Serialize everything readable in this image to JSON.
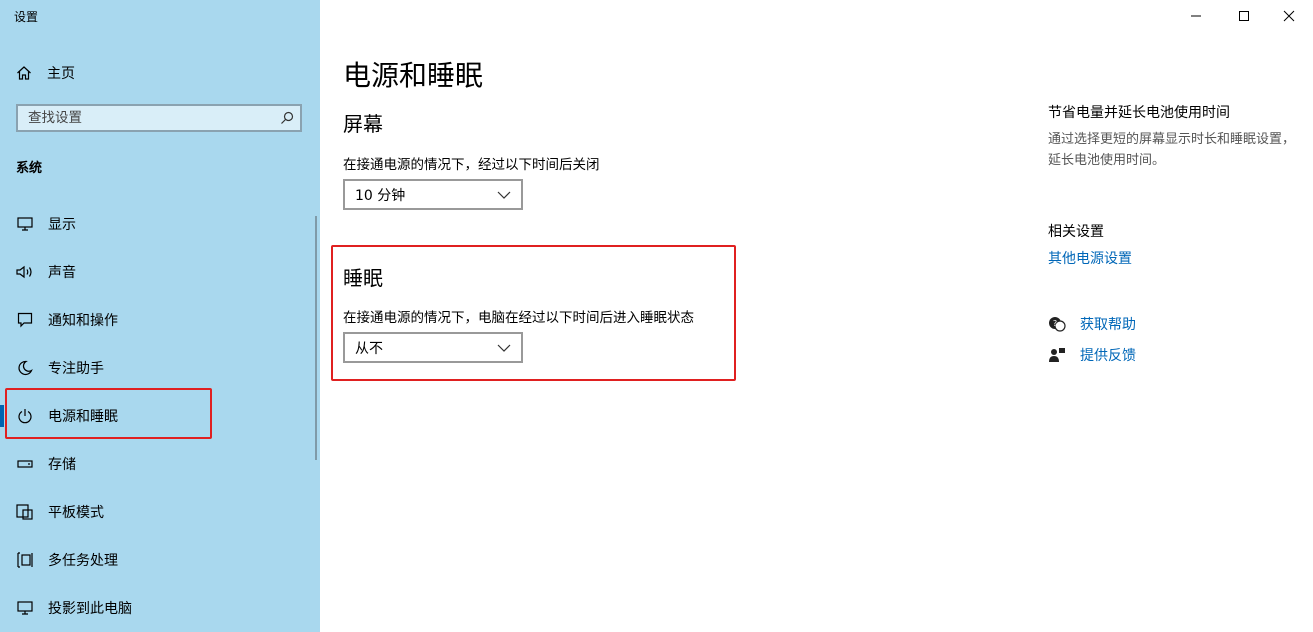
{
  "window": {
    "title": "设置",
    "minimize_glyph": "—",
    "maximize_glyph": "☐",
    "close_glyph": "✕"
  },
  "sidebar": {
    "home": {
      "label": "主页",
      "icon": "home-icon"
    },
    "search": {
      "placeholder": "查找设置",
      "icon": "search-icon"
    },
    "section": "系统",
    "items": [
      {
        "label": "显示",
        "icon": "display-icon"
      },
      {
        "label": "声音",
        "icon": "speaker-icon"
      },
      {
        "label": "通知和操作",
        "icon": "notification-icon"
      },
      {
        "label": "专注助手",
        "icon": "moon-icon"
      },
      {
        "label": "电源和睡眠",
        "icon": "power-icon",
        "selected": true
      },
      {
        "label": "存储",
        "icon": "storage-icon"
      },
      {
        "label": "平板模式",
        "icon": "tablet-icon"
      },
      {
        "label": "多任务处理",
        "icon": "multitask-icon"
      },
      {
        "label": "投影到此电脑",
        "icon": "project-icon"
      }
    ]
  },
  "main": {
    "title": "电源和睡眠",
    "screen": {
      "heading": "屏幕",
      "description": "在接通电源的情况下，经过以下时间后关闭",
      "value": "10 分钟"
    },
    "sleep": {
      "heading": "睡眠",
      "description": "在接通电源的情况下，电脑在经过以下时间后进入睡眠状态",
      "value": "从不"
    }
  },
  "right_panel": {
    "tip_title": "节省电量并延长电池使用时间",
    "tip_text": "通过选择更短的屏幕显示时长和睡眠设置，延长电池使用时间。",
    "related_title": "相关设置",
    "related_link": "其他电源设置",
    "help": {
      "label": "获取帮助",
      "icon": "help-chat-icon"
    },
    "feedback": {
      "label": "提供反馈",
      "icon": "feedback-icon"
    }
  },
  "colors": {
    "sidebar_bg": "#a9d8ee",
    "accent": "#0063b1",
    "link": "#0067b8",
    "highlight": "#e02020"
  }
}
